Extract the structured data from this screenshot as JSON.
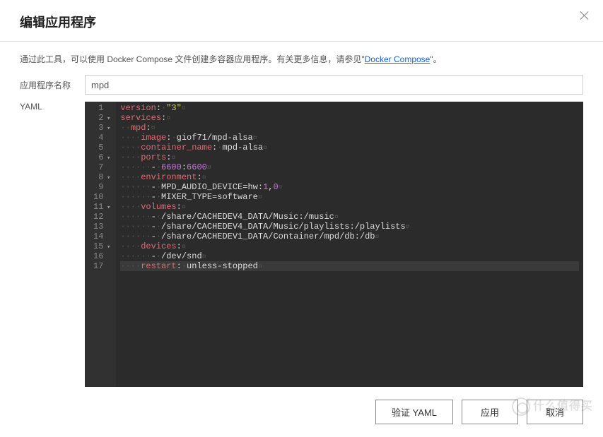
{
  "header": {
    "title": "编辑应用程序"
  },
  "intro": {
    "prefix": "通过此工具，可以使用 Docker Compose 文件创建多容器应用程序。有关更多信息，请参见\"",
    "link_text": "Docker Compose",
    "suffix": "\"。"
  },
  "form": {
    "name_label": "应用程序名称",
    "name_value": "mpd",
    "yaml_label": "YAML"
  },
  "yaml": {
    "raw": "version: \"3\"\nservices:\n  mpd:\n    image: giof71/mpd-alsa\n    container_name: mpd-alsa\n    ports:\n      - 6600:6600\n    environment:\n      - MPD_AUDIO_DEVICE=hw:1,0\n      - MIXER_TYPE=software\n    volumes:\n      - /share/CACHEDEV4_DATA/Music:/music\n      - /share/CACHEDEV4_DATA/Music/playlists:/playlists\n      - /share/CACHEDEV1_DATA/Container/mpd/db:/db\n    devices:\n      - /dev/snd\n    restart: unless-stopped",
    "lines": [
      {
        "n": 1,
        "fold": false,
        "indent": 0,
        "tokens": [
          [
            "key",
            "version"
          ],
          [
            "punc",
            ":"
          ],
          [
            "ws",
            " "
          ],
          [
            "str",
            "\"3\""
          ]
        ]
      },
      {
        "n": 2,
        "fold": true,
        "indent": 0,
        "tokens": [
          [
            "key",
            "services"
          ],
          [
            "punc",
            ":"
          ]
        ]
      },
      {
        "n": 3,
        "fold": true,
        "indent": 2,
        "tokens": [
          [
            "key",
            "mpd"
          ],
          [
            "punc",
            ":"
          ]
        ]
      },
      {
        "n": 4,
        "fold": false,
        "indent": 4,
        "tokens": [
          [
            "key",
            "image"
          ],
          [
            "punc",
            ":"
          ],
          [
            "ws",
            " "
          ],
          [
            "val",
            "giof71/mpd-alsa"
          ]
        ]
      },
      {
        "n": 5,
        "fold": false,
        "indent": 4,
        "tokens": [
          [
            "key",
            "container_name"
          ],
          [
            "punc",
            ":"
          ],
          [
            "ws",
            " "
          ],
          [
            "val",
            "mpd-alsa"
          ]
        ]
      },
      {
        "n": 6,
        "fold": true,
        "indent": 4,
        "tokens": [
          [
            "key",
            "ports"
          ],
          [
            "punc",
            ":"
          ]
        ]
      },
      {
        "n": 7,
        "fold": false,
        "indent": 6,
        "tokens": [
          [
            "punc",
            "-"
          ],
          [
            "ws",
            " "
          ],
          [
            "num",
            "6600"
          ],
          [
            "punc",
            ":"
          ],
          [
            "num",
            "6600"
          ]
        ]
      },
      {
        "n": 8,
        "fold": true,
        "indent": 4,
        "tokens": [
          [
            "key",
            "environment"
          ],
          [
            "punc",
            ":"
          ]
        ]
      },
      {
        "n": 9,
        "fold": false,
        "indent": 6,
        "tokens": [
          [
            "punc",
            "-"
          ],
          [
            "ws",
            " "
          ],
          [
            "val",
            "MPD_AUDIO_DEVICE=hw"
          ],
          [
            "punc",
            ":"
          ],
          [
            "num",
            "1"
          ],
          [
            "punc",
            ","
          ],
          [
            "num",
            "0"
          ]
        ]
      },
      {
        "n": 10,
        "fold": false,
        "indent": 6,
        "tokens": [
          [
            "punc",
            "-"
          ],
          [
            "ws",
            " "
          ],
          [
            "val",
            "MIXER_TYPE=software"
          ]
        ]
      },
      {
        "n": 11,
        "fold": true,
        "indent": 4,
        "tokens": [
          [
            "key",
            "volumes"
          ],
          [
            "punc",
            ":"
          ]
        ]
      },
      {
        "n": 12,
        "fold": false,
        "indent": 6,
        "tokens": [
          [
            "punc",
            "-"
          ],
          [
            "ws",
            " "
          ],
          [
            "val",
            "/share/CACHEDEV4_DATA/Music"
          ],
          [
            "punc",
            ":"
          ],
          [
            "val",
            "/music"
          ]
        ]
      },
      {
        "n": 13,
        "fold": false,
        "indent": 6,
        "tokens": [
          [
            "punc",
            "-"
          ],
          [
            "ws",
            " "
          ],
          [
            "val",
            "/share/CACHEDEV4_DATA/Music/playlists"
          ],
          [
            "punc",
            ":"
          ],
          [
            "val",
            "/playlists"
          ]
        ]
      },
      {
        "n": 14,
        "fold": false,
        "indent": 6,
        "tokens": [
          [
            "punc",
            "-"
          ],
          [
            "ws",
            " "
          ],
          [
            "val",
            "/share/CACHEDEV1_DATA/Container/mpd/db"
          ],
          [
            "punc",
            ":"
          ],
          [
            "val",
            "/db"
          ]
        ]
      },
      {
        "n": 15,
        "fold": true,
        "indent": 4,
        "tokens": [
          [
            "key",
            "devices"
          ],
          [
            "punc",
            ":"
          ]
        ]
      },
      {
        "n": 16,
        "fold": false,
        "indent": 6,
        "tokens": [
          [
            "punc",
            "-"
          ],
          [
            "ws",
            " "
          ],
          [
            "val",
            "/dev/snd"
          ]
        ]
      },
      {
        "n": 17,
        "fold": false,
        "indent": 4,
        "hl": true,
        "tokens": [
          [
            "key",
            "restart"
          ],
          [
            "punc",
            ":"
          ],
          [
            "ws",
            " "
          ],
          [
            "val",
            "unless-stopped"
          ]
        ]
      }
    ]
  },
  "buttons": {
    "validate": "验证 YAML",
    "apply": "应用",
    "cancel": "取消"
  },
  "watermark": "什么值得买"
}
